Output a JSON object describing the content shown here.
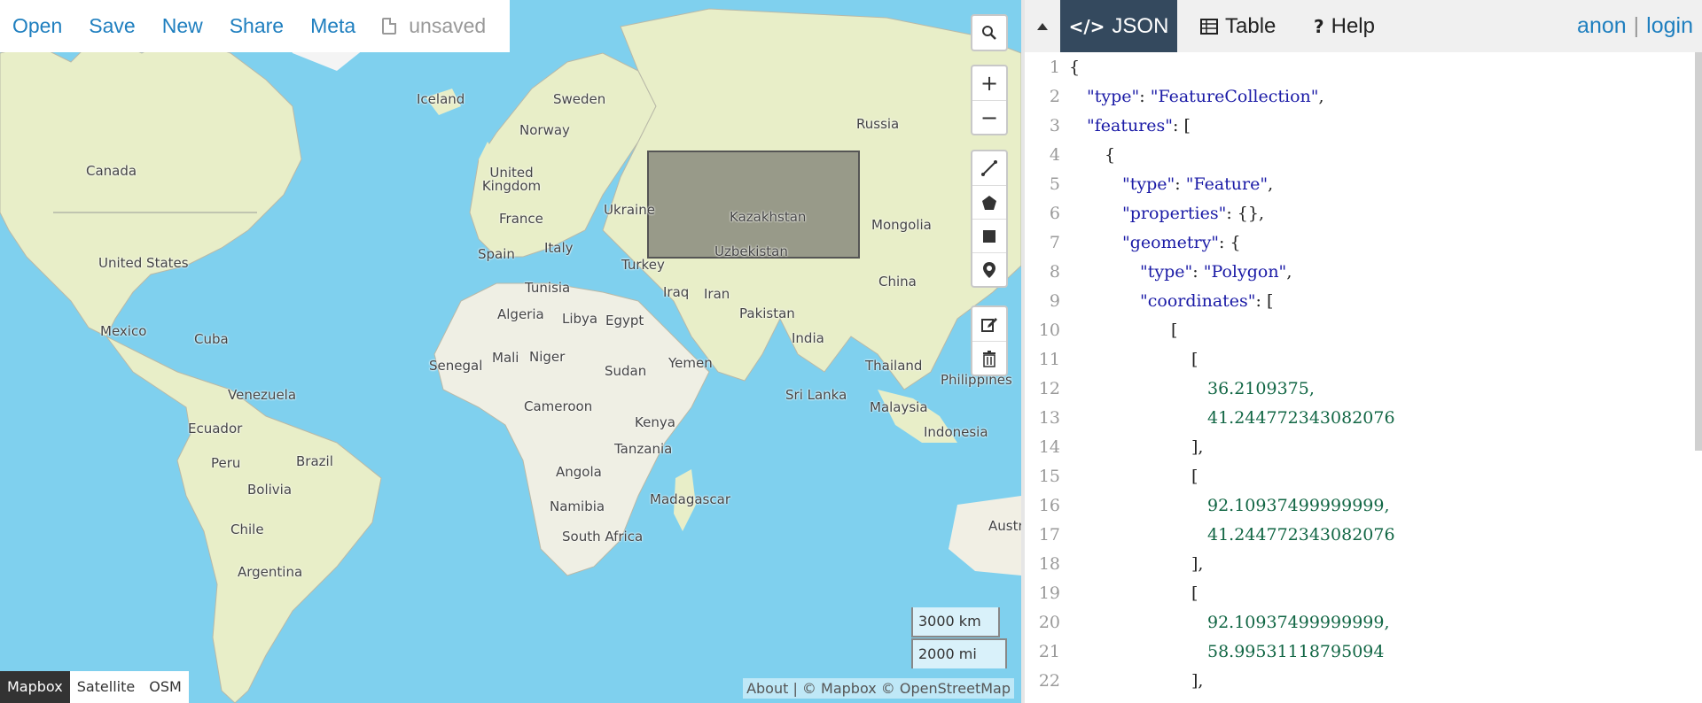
{
  "toolbar": {
    "open": "Open",
    "save": "Save",
    "new": "New",
    "share": "Share",
    "meta": "Meta",
    "status": "unsaved"
  },
  "map": {
    "labels": {
      "iceland": "Iceland",
      "sweden": "Sweden",
      "norway": "Norway",
      "russia": "Russia",
      "canada": "Canada",
      "uk": "United Kingdom",
      "ukraine": "Ukraine",
      "france": "France",
      "kazakhstan": "Kazakhstan",
      "mongolia": "Mongolia",
      "us": "United States",
      "spain": "Spain",
      "italy": "Italy",
      "turkey": "Turkey",
      "uzbekistan": "Uzbekistan",
      "china": "China",
      "tunisia": "Tunisia",
      "iraq": "Iraq",
      "iran": "Iran",
      "algeria": "Algeria",
      "libya": "Libya",
      "egypt": "Egypt",
      "pakistan": "Pakistan",
      "mexico": "Mexico",
      "cuba": "Cuba",
      "india": "India",
      "senegal": "Senegal",
      "mali": "Mali",
      "niger": "Niger",
      "sudan": "Sudan",
      "yemen": "Yemen",
      "thailand": "Thailand",
      "philippines": "Philippines",
      "venezuela": "Venezuela",
      "srilanka": "Sri Lanka",
      "cameroon": "Cameroon",
      "malaysia": "Malaysia",
      "ecuador": "Ecuador",
      "kenya": "Kenya",
      "indonesia": "Indonesia",
      "peru": "Peru",
      "brazil": "Brazil",
      "tanzania": "Tanzania",
      "bolivia": "Bolivia",
      "angola": "Angola",
      "madagascar": "Madagascar",
      "namibia": "Namibia",
      "chile": "Chile",
      "southafrica": "South Africa",
      "argentina": "Argentina",
      "australia": "Austr"
    },
    "controls": {
      "search_icon": "⌕",
      "zoom_in": "+",
      "zoom_out": "−"
    },
    "scale": {
      "km": "3000 km",
      "mi": "2000 mi"
    },
    "layers": [
      "Mapbox",
      "Satellite",
      "OSM"
    ],
    "active_layer": "Mapbox",
    "attribution": "About | © Mapbox © OpenStreetMap"
  },
  "pane": {
    "tabs": {
      "json": "JSON",
      "table": "Table",
      "help": "Help"
    },
    "user": {
      "anon": "anon",
      "sep": "|",
      "login": "login"
    }
  },
  "editor": {
    "lines": [
      "1",
      "2",
      "3",
      "4",
      "5",
      "6",
      "7",
      "8",
      "9",
      "10",
      "11",
      "12",
      "13",
      "14",
      "15",
      "16",
      "17",
      "18",
      "19",
      "20",
      "21",
      "22"
    ],
    "code": {
      "l1": "{",
      "l2_key": "\"type\"",
      "l2_val": "\"FeatureCollection\"",
      "l3_key": "\"features\"",
      "l3_rest": ": [",
      "l4": "{",
      "l5_key": "\"type\"",
      "l5_val": "\"Feature\"",
      "l6_key": "\"properties\"",
      "l6_rest": ": {},",
      "l7_key": "\"geometry\"",
      "l7_rest": ": {",
      "l8_key": "\"type\"",
      "l8_val": "\"Polygon\"",
      "l9_key": "\"coordinates\"",
      "l9_rest": ": [",
      "l10": "[",
      "l11": "[",
      "l12": "36.2109375,",
      "l13": "41.244772343082076",
      "l14": "],",
      "l15": "[",
      "l16": "92.10937499999999,",
      "l17": "41.244772343082076",
      "l18": "],",
      "l19": "[",
      "l20": "92.10937499999999,",
      "l21": "58.99531118795094",
      "l22": "],"
    }
  }
}
